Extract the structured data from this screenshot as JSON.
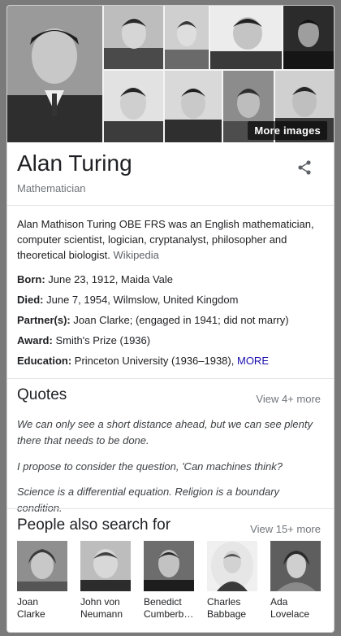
{
  "images": {
    "more_label": "More images"
  },
  "header": {
    "title": "Alan Turing",
    "subtitle": "Mathematician"
  },
  "description": {
    "text": "Alan Mathison Turing OBE FRS was an English mathematician, computer scientist, logician, cryptanalyst, philosopher and theoretical biologist.",
    "source": "Wikipedia"
  },
  "facts": [
    {
      "label": "Born:",
      "value": "June 23, 1912, Maida Vale"
    },
    {
      "label": "Died:",
      "value": "June 7, 1954, Wilmslow, United Kingdom"
    },
    {
      "label": "Partner(s):",
      "value": "Joan Clarke; (engaged in 1941; did not marry)"
    },
    {
      "label": "Award:",
      "value": "Smith's Prize (1936)"
    },
    {
      "label": "Education:",
      "value": "Princeton University (1936–1938),",
      "more": "MORE"
    }
  ],
  "quotes": {
    "title": "Quotes",
    "view_more": "View 4+ more",
    "items": [
      "We can only see a short distance ahead, but we can see plenty there that needs to be done.",
      "I propose to consider the question, 'Can machines think?",
      "Science is a differential equation. Religion is a boundary condition."
    ]
  },
  "people": {
    "title": "People also search for",
    "view_more": "View 15+ more",
    "items": [
      {
        "line1": "Joan",
        "line2": "Clarke"
      },
      {
        "line1": "John von",
        "line2": "Neumann"
      },
      {
        "line1": "Benedict",
        "line2": "Cumberb…"
      },
      {
        "line1": "Charles",
        "line2": "Babbage"
      },
      {
        "line1": "Ada",
        "line2": "Lovelace"
      }
    ]
  }
}
